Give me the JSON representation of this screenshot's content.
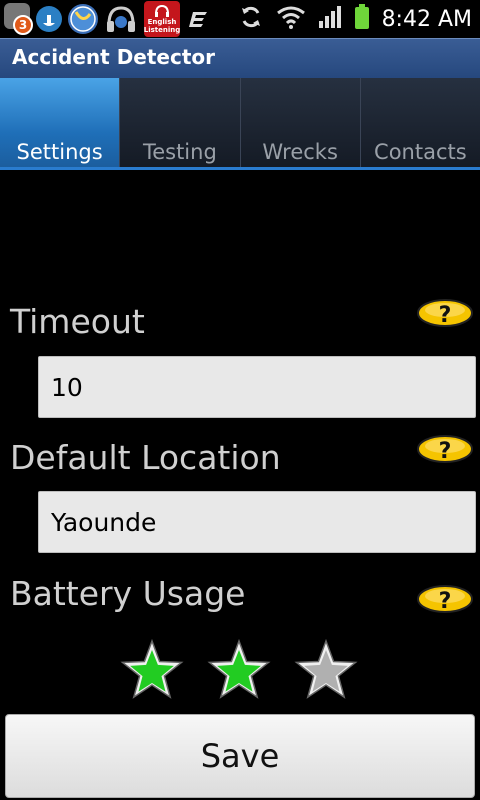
{
  "status_bar": {
    "notification_count": "3",
    "app_icon_text": "English Listening",
    "time": "8:42 AM"
  },
  "app": {
    "title": "Accident Detector"
  },
  "tabs": [
    {
      "label": "Settings",
      "selected": true
    },
    {
      "label": "Testing",
      "selected": false
    },
    {
      "label": "Wrecks",
      "selected": false
    },
    {
      "label": "Contacts",
      "selected": false
    }
  ],
  "settings": {
    "timeout": {
      "label": "Timeout",
      "value": "10"
    },
    "location": {
      "label": "Default Location",
      "value": "Yaounde"
    },
    "battery": {
      "label": "Battery Usage",
      "rating": 2,
      "max": 3
    }
  },
  "save_label": "Save",
  "colors": {
    "selected_tab": "#2f86d6",
    "title_bar": "#2f5288",
    "help_icon": "#f5c400",
    "star_active": "#22cc22",
    "star_inactive": "#b0b0b0"
  }
}
